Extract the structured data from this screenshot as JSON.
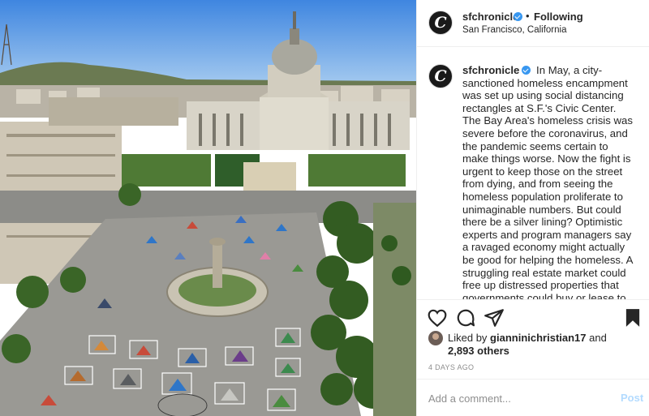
{
  "post": {
    "photo_alt": "",
    "header": {
      "avatar_letter": "C",
      "username": "sfchronicle",
      "separator": "•",
      "follow_label": "Following",
      "location": "San Francisco, California"
    },
    "caption": {
      "username": "sfchronicle",
      "text": "In May, a city-sanctioned homeless encampment was set up using social distancing rectangles at S.F.'s Civic Center. The Bay Area's homeless crisis was severe before the coronavirus, and the pandemic seems certain to make things worse. Now the fight is urgent to keep those on the street from dying, and from seeing the homeless population proliferate to unimaginable numbers. But could there be a silver lining? Optimistic experts and program managers say a ravaged economy might actually be good for helping the homeless. A struggling real estate market could free up distressed properties that governments could buy or lease to"
    },
    "likes": {
      "prefix": "Liked by",
      "liker": "gianninichristian17",
      "joiner": "and",
      "others": "2,893 others"
    },
    "time_ago": "4 DAYS AGO",
    "comment": {
      "placeholder": "Add a comment...",
      "post_label": "Post"
    }
  },
  "icons": {
    "like": "heart-outline-icon",
    "comment": "speech-bubble-icon",
    "share": "paper-plane-icon",
    "save": "bookmark-filled-icon",
    "verified": "verified-badge-icon"
  },
  "colors": {
    "verified_blue": "#3897f0",
    "post_disabled": "#b3dbff",
    "muted_text": "#8e8e8e",
    "divider": "#efefef"
  }
}
